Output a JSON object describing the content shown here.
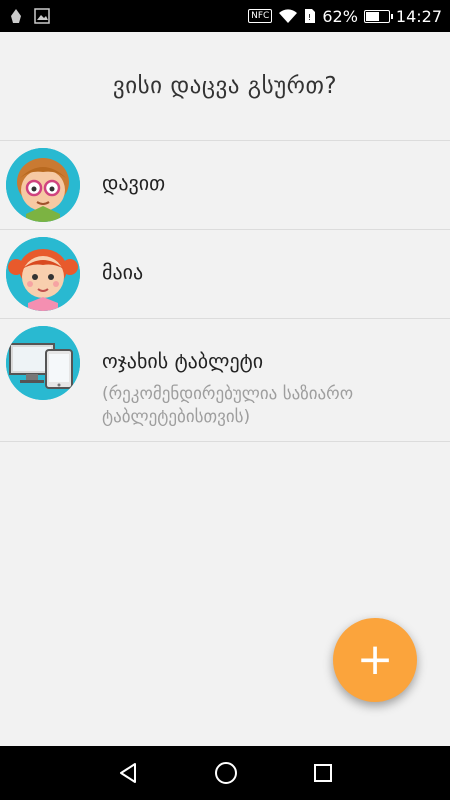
{
  "status_bar": {
    "nfc_label": "NFC",
    "battery_percent": "62%",
    "battery_level": 0.62,
    "time": "14:27"
  },
  "header": {
    "title": "ვისი დაცვა გსურთ?"
  },
  "profiles": [
    {
      "name": "დავით",
      "avatar": "boy-avatar-icon"
    },
    {
      "name": "მაია",
      "avatar": "girl-avatar-icon"
    },
    {
      "name": "ოჯახის ტაბლეტი",
      "subtitle": "(რეკომენდირებულია საზიარო ტაბლეტებისთვის)",
      "avatar": "devices-avatar-icon"
    }
  ],
  "fab": {
    "label": "+",
    "accent": "#fba43c"
  },
  "nav": {
    "back": "back-icon",
    "home": "home-icon",
    "recents": "recents-icon"
  }
}
